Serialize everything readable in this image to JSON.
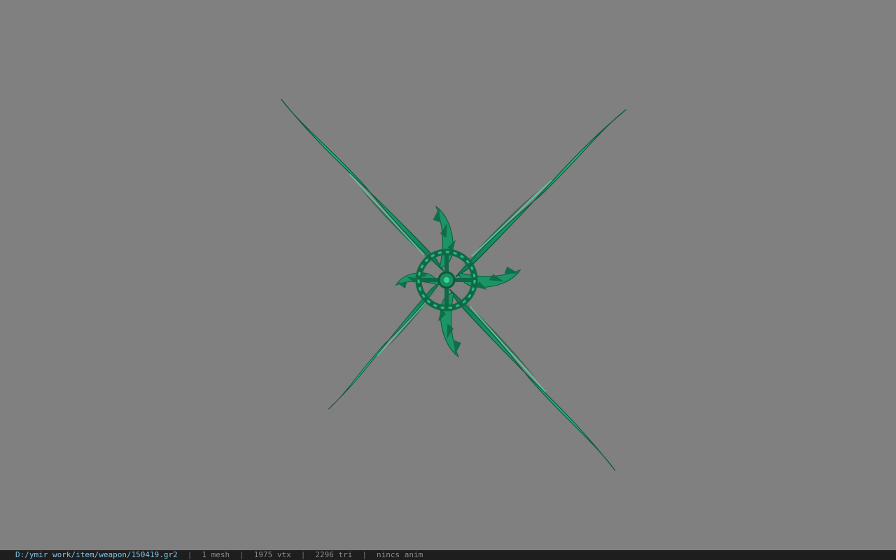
{
  "status_bar": {
    "file_path": "D:/ymir work/item/weapon/150419.gr2",
    "mesh_count": "1 mesh",
    "vertex_count": "1975 vtx",
    "triangle_count": "2296 tri",
    "animation": "nincs anim",
    "separator": "|"
  },
  "colors": {
    "background": "#808080",
    "statusbar_background": "#1e1e1e",
    "path_text": "#7ec4e8",
    "status_text": "#8a8a8a",
    "model_light": "#3ecf96",
    "model_mid": "#1fa472",
    "model_dark": "#0b5a3c"
  }
}
